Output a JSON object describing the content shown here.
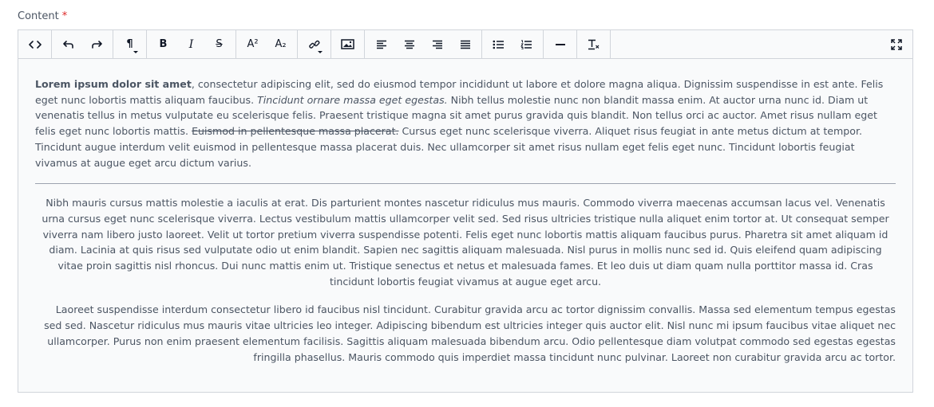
{
  "field": {
    "label": "Content",
    "required_mark": "*"
  },
  "toolbar": {
    "buttons": {
      "source": "source-code",
      "undo": "undo",
      "redo": "redo",
      "paragraph": "¶",
      "bold": "B",
      "italic": "I",
      "strike": "S",
      "superscript": "A²",
      "subscript": "A₂",
      "link": "link",
      "image": "image",
      "align_left": "align-left",
      "align_center": "align-center",
      "align_right": "align-right",
      "align_justify": "align-justify",
      "bullet_list": "bullet-list",
      "ordered_list": "ordered-list",
      "horizontal_rule": "horizontal-rule",
      "clear_format": "Tx",
      "fullscreen": "fullscreen"
    }
  },
  "content": {
    "p1": {
      "bold": "Lorem ipsum dolor sit amet",
      "text1": ", consectetur adipiscing elit, sed do eiusmod tempor incididunt ut labore et dolore magna aliqua. Dignissim suspendisse in est ante. Felis eget nunc lobortis mattis aliquam faucibus. ",
      "italic": "Tincidunt ornare massa eget egestas.",
      "text2": " Nibh tellus molestie nunc non blandit massa enim. At auctor urna nunc id. Diam ut venenatis tellus in metus vulputate eu scelerisque felis. Praesent tristique magna sit amet purus gravida quis blandit. Non tellus orci ac auctor. Amet risus nullam eget felis eget nunc lobortis mattis. ",
      "strike": "Euismod in pellentesque massa placerat.",
      "text3": " Cursus eget nunc scelerisque viverra. Aliquet risus feugiat in ante metus dictum at tempor. Tincidunt augue interdum velit euismod in pellentesque massa placerat duis. Nec ullamcorper sit amet risus nullam eget felis eget nunc. Tincidunt lobortis feugiat vivamus at augue eget arcu dictum varius."
    },
    "p2": "Nibh mauris cursus mattis molestie a iaculis at erat. Dis parturient montes nascetur ridiculus mus mauris. Commodo viverra maecenas accumsan lacus vel. Venenatis urna cursus eget nunc scelerisque viverra. Lectus vestibulum mattis ullamcorper velit sed. Sed risus ultricies tristique nulla aliquet enim tortor at. Ut consequat semper viverra nam libero justo laoreet. Velit ut tortor pretium viverra suspendisse potenti. Felis eget nunc lobortis mattis aliquam faucibus purus. Pharetra sit amet aliquam id diam. Lacinia at quis risus sed vulputate odio ut enim blandit. Sapien nec sagittis aliquam malesuada. Nisl purus in mollis nunc sed id. Quis eleifend quam adipiscing vitae proin sagittis nisl rhoncus. Dui nunc mattis enim ut. Tristique senectus et netus et malesuada fames. Et leo duis ut diam quam nulla porttitor massa id. Cras tincidunt lobortis feugiat vivamus at augue eget arcu.",
    "p3": "Laoreet suspendisse interdum consectetur libero id faucibus nisl tincidunt. Curabitur gravida arcu ac tortor dignissim convallis. Massa sed elementum tempus egestas sed sed. Nascetur ridiculus mus mauris vitae ultricies leo integer. Adipiscing bibendum est ultricies integer quis auctor elit. Nisl nunc mi ipsum faucibus vitae aliquet nec ullamcorper. Purus non enim praesent elementum facilisis. Sagittis aliquam malesuada bibendum arcu. Odio pellentesque diam volutpat commodo sed egestas egestas fringilla phasellus. Mauris commodo quis imperdiet massa tincidunt nunc pulvinar. Laoreet non curabitur gravida arcu ac tortor."
  },
  "colors": {
    "label": "#4b5563",
    "required": "#dc2626",
    "border": "#d1d5db",
    "editor_bg": "#f9fafb",
    "text": "#4b5563"
  }
}
